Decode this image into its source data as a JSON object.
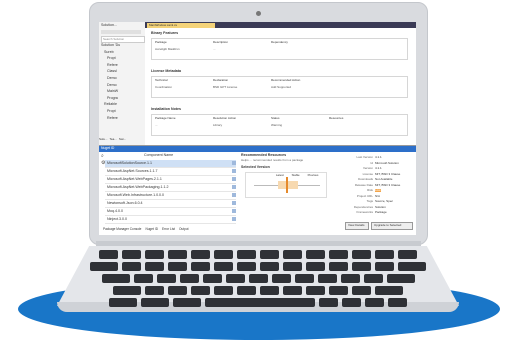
{
  "colors": {
    "accent": "#2d6fc9",
    "floor": "#1976c8",
    "tab_active": "#f4d37a"
  },
  "solution": {
    "title": "Solution...",
    "search_placeholder": "Search Solution",
    "items": [
      "Solution 'Du",
      "Sureb",
      "Propt",
      "Refere",
      "Classl",
      "Demo",
      "Demo",
      "MainW",
      "Progra",
      "Reliable",
      "Propt",
      "Refere"
    ],
    "footer_tabs": [
      "Solu...",
      "Tea...",
      "Swi..."
    ]
  },
  "editor": {
    "tab_label": "MainWindow.xaml.cs",
    "sections": [
      {
        "heading": "Binary Features",
        "cols": [
          "Package",
          "Description",
          "Dependency"
        ],
        "row": [
          "Axceligib Maddrsn",
          "..."
        ]
      },
      {
        "heading": "License Metadata",
        "cols": [
          "Technical",
          "Declaration",
          "Recommended Action"
        ],
        "row": [
          "Coordination",
          "BSD GPT License",
          "Add Supported"
        ]
      },
      {
        "heading": "Installation Notes",
        "cols": [
          "Package Name",
          "Resolution Action",
          "Status",
          "Resources"
        ],
        "row": [
          "...",
          "Library",
          "Warning"
        ]
      }
    ]
  },
  "nuget": {
    "title": "Nuget ID",
    "list_header": "Component Name",
    "packages": [
      {
        "name": "MicrosoftSolutionSource.1.1",
        "selected": true
      },
      {
        "name": "Microsoft.AspNet.Sources.1.1.7",
        "selected": false
      },
      {
        "name": "Microsoft.AspNet.WebPages.2.1.1",
        "selected": false
      },
      {
        "name": "Microsoft.AspNet.WebPackaging.1.1.2",
        "selected": false
      },
      {
        "name": "Microsoft.Web.Infrastructure.1.0.0.0",
        "selected": false
      },
      {
        "name": "Newtonsoft.Json.6.0.4",
        "selected": false
      },
      {
        "name": "Moq.4.0.0",
        "selected": false
      },
      {
        "name": "Ninject.3.0.0",
        "selected": false
      }
    ],
    "detail_title": "Recommended Resources",
    "detail_text": "Helps ... recommended results from a package",
    "version_label": "Selected Version",
    "chart_labels": [
      "Latest",
      "Stable",
      "Previous"
    ],
    "props": [
      {
        "k": "Last Version",
        "v": "4.1.1"
      },
      {
        "k": "Id",
        "v": "Microsoft.Solution"
      },
      {
        "k": "Version",
        "v": "4.1.1"
      },
      {
        "k": "License",
        "v": "MIT, BSD 3 Clause"
      },
      {
        "k": "Downloads",
        "v": "Not Available"
      },
      {
        "k": "Release Date",
        "v": "MIT, BSD 3 Clause"
      },
      {
        "k": "Risk",
        "v": "Low"
      },
      {
        "k": "Project URL",
        "v": "N/A"
      },
      {
        "k": "Tags",
        "v": "Source, Spec"
      },
      {
        "k": "Dependencies",
        "v": "Solution"
      },
      {
        "k": "Frameworks",
        "v": "Package"
      }
    ],
    "buttons": [
      "View Details",
      "Upgrade to Selected"
    ],
    "bottom_tabs": [
      "Package Manager Console",
      "Nuget ID",
      "Error List",
      "Output"
    ]
  }
}
